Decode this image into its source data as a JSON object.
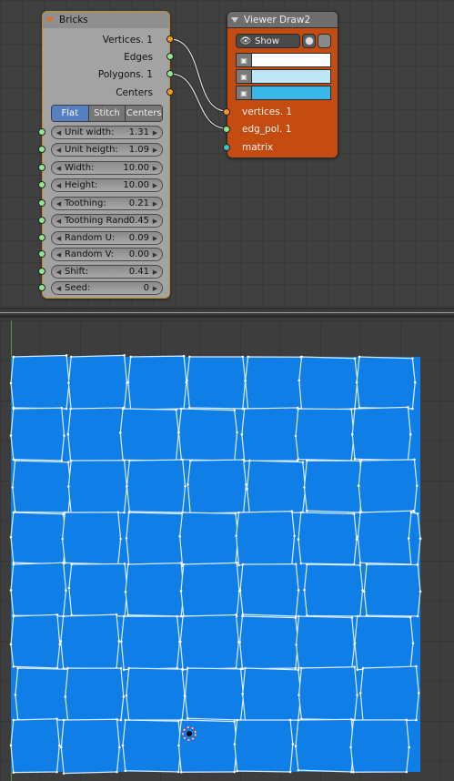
{
  "bricks_node": {
    "title": "Bricks",
    "outputs": [
      "Vertices. 1",
      "Edges",
      "Polygons. 1",
      "Centers"
    ],
    "modes": [
      {
        "label": "Flat",
        "active": true
      },
      {
        "label": "Stitch",
        "active": false
      },
      {
        "label": "Centers",
        "active": false
      }
    ],
    "fields": [
      {
        "label": "Unit width:",
        "value": "1.31"
      },
      {
        "label": "Unit heigth:",
        "value": "1.09"
      },
      {
        "label": "Width:",
        "value": "10.00"
      },
      {
        "label": "Height:",
        "value": "10.00"
      },
      {
        "label": "Toothing:",
        "value": "0.21"
      },
      {
        "label": "Toothing Rand:",
        "value": "0.45"
      },
      {
        "label": "Random U:",
        "value": "0.09"
      },
      {
        "label": "Random V:",
        "value": "0.00"
      },
      {
        "label": "Shift:",
        "value": "0.41"
      },
      {
        "label": "Seed:",
        "value": "0"
      }
    ]
  },
  "viewer_node": {
    "title": "Viewer Draw2",
    "show_label": "Show",
    "colors": [
      {
        "icon": "vertex-color-icon",
        "color": "#ffffff"
      },
      {
        "icon": "edge-color-icon",
        "color": "#bde6f6"
      },
      {
        "icon": "face-color-icon",
        "color": "#37b6e8"
      }
    ],
    "inputs": [
      "vertices. 1",
      "edg_pol. 1",
      "matrix"
    ]
  },
  "viewport": {
    "face_color": "#0f7ee6",
    "edge_color": "#dcecff",
    "grid_color": "#363636"
  },
  "colors": {
    "node_header": "#8f8f8f",
    "viewer_body": "#c44c10",
    "active_mode": "#5680c2",
    "output_socket": "#ee9a2a",
    "input_socket": "#8ee88e",
    "matrix_socket": "#3ec8c8"
  }
}
